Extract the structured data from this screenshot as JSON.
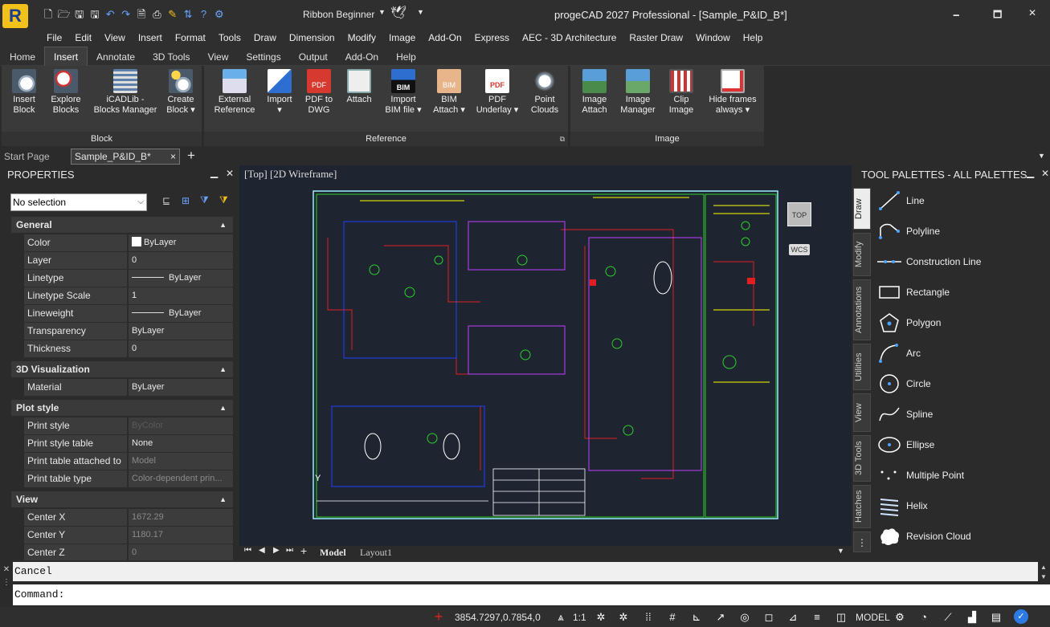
{
  "title_bar": {
    "window_title": "progeCAD 2027 Professional - [Sample_P&ID_B*]",
    "workspace": "Ribbon Beginner",
    "min": "🗕",
    "max": "🗖",
    "close": "✕"
  },
  "menu": [
    "File",
    "Edit",
    "View",
    "Insert",
    "Format",
    "Tools",
    "Draw",
    "Dimension",
    "Modify",
    "Image",
    "Add-On",
    "Express",
    "AEC - 3D Architecture",
    "Raster Draw",
    "Window",
    "Help"
  ],
  "ribbon_tabs": [
    "Home",
    "Insert",
    "Annotate",
    "3D Tools",
    "View",
    "Settings",
    "Output",
    "Add-On",
    "Help"
  ],
  "ribbon_active": "Insert",
  "ribbon": {
    "block": {
      "label": "Block",
      "buttons": [
        [
          "Insert",
          "Block"
        ],
        [
          "Explore",
          "Blocks"
        ],
        [
          "iCADLib -",
          "Blocks Manager"
        ],
        [
          "Create",
          "Block ▾"
        ]
      ]
    },
    "reference": {
      "label": "Reference",
      "buttons": [
        [
          "External",
          "Reference"
        ],
        [
          "Import",
          "▾"
        ],
        [
          "PDF to",
          "DWG"
        ],
        [
          "Attach",
          ""
        ],
        [
          "Import",
          "BIM file ▾"
        ],
        [
          "BIM",
          "Attach ▾"
        ],
        [
          "PDF",
          "Underlay ▾"
        ],
        [
          "Point",
          "Clouds"
        ]
      ]
    },
    "image": {
      "label": "Image",
      "buttons": [
        [
          "Image",
          "Attach"
        ],
        [
          "Image",
          "Manager"
        ],
        [
          "Clip",
          "Image"
        ],
        [
          "Hide frames",
          "always ▾"
        ]
      ]
    }
  },
  "doc_tabs": {
    "start": "Start Page",
    "active": "Sample_P&ID_B*",
    "close": "×",
    "add": "+"
  },
  "properties": {
    "title": "PROPERTIES",
    "selection": "No selection",
    "sections": {
      "general": {
        "label": "General",
        "rows": [
          [
            "Color",
            "ByLayer"
          ],
          [
            "Layer",
            "0"
          ],
          [
            "Linetype",
            "ByLayer"
          ],
          [
            "Linetype Scale",
            "1"
          ],
          [
            "Lineweight",
            "ByLayer"
          ],
          [
            "Transparency",
            "ByLayer"
          ],
          [
            "Thickness",
            "0"
          ]
        ]
      },
      "viz": {
        "label": "3D Visualization",
        "rows": [
          [
            "Material",
            "ByLayer"
          ]
        ]
      },
      "plot": {
        "label": "Plot style",
        "rows": [
          [
            "Print style",
            "ByColor"
          ],
          [
            "Print style table",
            "None"
          ],
          [
            "Print table attached to",
            "Model"
          ],
          [
            "Print table type",
            "Color-dependent prin..."
          ]
        ]
      },
      "view": {
        "label": "View",
        "rows": [
          [
            "Center X",
            "1672.29"
          ],
          [
            "Center Y",
            "1180.17"
          ],
          [
            "Center Z",
            "0"
          ]
        ]
      }
    }
  },
  "viewport": {
    "label": "[Top] [2D Wireframe]",
    "cube": "TOP",
    "wcs": "WCS",
    "axis_y": "Y",
    "tabs": [
      "Model",
      "Layout1"
    ]
  },
  "palette": {
    "title": "TOOL PALETTES - ALL PALETTES",
    "tabs": [
      "Draw",
      "Modify",
      "Annotations",
      "Utilities",
      "View",
      "3D Tools",
      "Hatches"
    ],
    "items": [
      "Line",
      "Polyline",
      "Construction Line",
      "Rectangle",
      "Polygon",
      "Arc",
      "Circle",
      "Spline",
      "Ellipse",
      "Multiple Point",
      "Helix",
      "Revision Cloud"
    ]
  },
  "command": {
    "history": "Cancel",
    "prompt": "Command:"
  },
  "status": {
    "coords": "3854.7297,0.7854,0",
    "scale": "1:1",
    "model": "MODEL"
  },
  "colors": {
    "accent": "#f2c21b",
    "canvas": "#1e2430"
  }
}
